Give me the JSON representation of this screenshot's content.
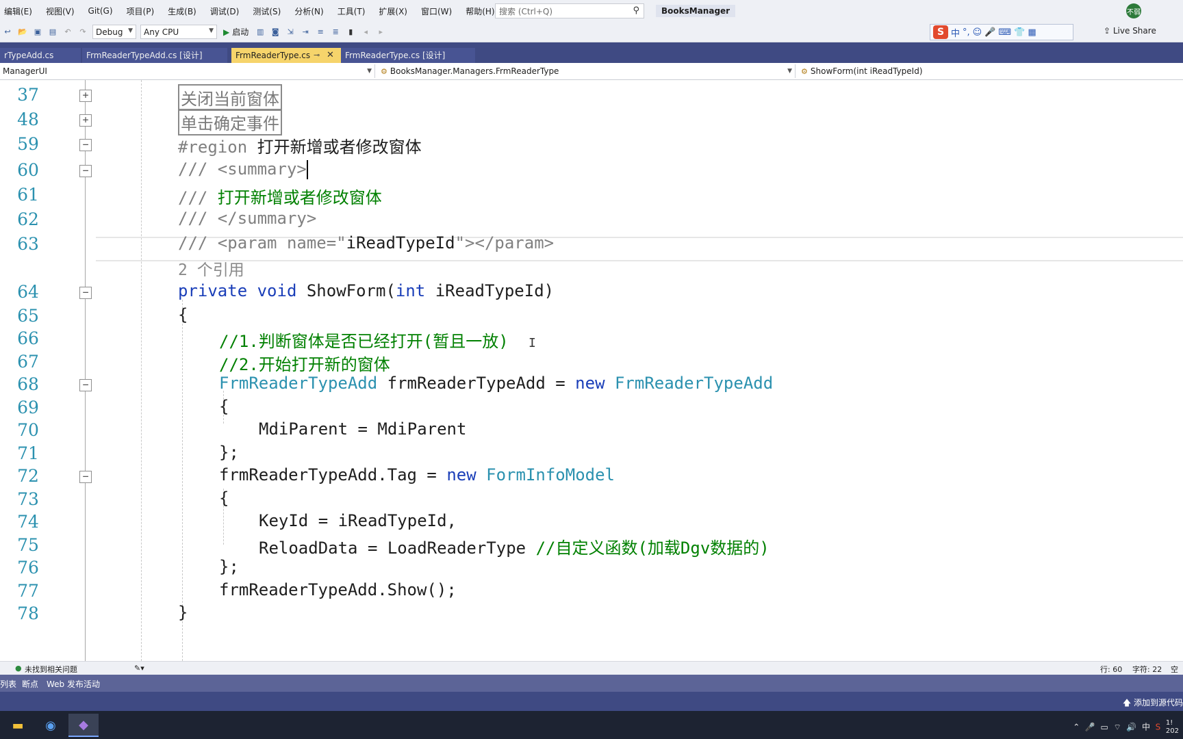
{
  "menubar": {
    "items": [
      "编辑(E)",
      "视图(V)",
      "Git(G)",
      "项目(P)",
      "生成(B)",
      "调试(D)",
      "测试(S)",
      "分析(N)",
      "工具(T)",
      "扩展(X)",
      "窗口(W)",
      "帮助(H)"
    ],
    "search_placeholder": "搜索 (Ctrl+Q)",
    "solution_name": "BooksManager",
    "avatar_text": "不弱"
  },
  "toolbar": {
    "config": "Debug",
    "platform": "Any CPU",
    "start_label": "启动",
    "ime_chars": [
      "中",
      "°,",
      "☺",
      "🎤",
      "⌨",
      "👕",
      "▦"
    ],
    "live_share": "Live Share"
  },
  "tabs": [
    {
      "label": "rTypeAdd.cs",
      "active": false
    },
    {
      "label": "FrmReaderTypeAdd.cs [设计]",
      "active": false
    },
    {
      "label": "FrmReaderType.cs",
      "active": true
    },
    {
      "label": "FrmReaderType.cs [设计]",
      "active": false
    }
  ],
  "navbar": {
    "project": "ManagerUI",
    "class": "BooksManager.Managers.FrmReaderType",
    "member": "ShowForm(int iReadTypeId)"
  },
  "editor": {
    "lines": [
      {
        "num": "37",
        "fold": "+",
        "text": "关闭当前窗体"
      },
      {
        "num": "48",
        "fold": "+",
        "text": "单击确定事件"
      },
      {
        "num": "59",
        "fold": "−",
        "kw": "#region",
        "text": " 打开新增或者修改窗体"
      },
      {
        "num": "60",
        "fold": "−",
        "text": "/// <summary>"
      },
      {
        "num": "61",
        "fold": "",
        "doc": "/// ",
        "text": "打开新增或者修改窗体"
      },
      {
        "num": "62",
        "fold": "",
        "text": "/// </summary>"
      },
      {
        "num": "63",
        "fold": "",
        "doc1": "/// <param name=\"",
        "text": "iReadTypeId",
        "doc2": "\"></param>"
      },
      {
        "num": "",
        "fold": "",
        "text": "2 个引用"
      },
      {
        "num": "64",
        "fold": "−",
        "kw1": "private",
        "kw2": "void",
        "name": "ShowForm(",
        "kw3": "int",
        "text": " iReadTypeId)"
      },
      {
        "num": "65",
        "fold": "",
        "text": "{"
      },
      {
        "num": "66",
        "fold": "",
        "text": "//1.判断窗体是否已经打开(暂且一放)"
      },
      {
        "num": "67",
        "fold": "",
        "text": "//2.开始打开新的窗体"
      },
      {
        "num": "68",
        "fold": "−",
        "type1": "FrmReaderTypeAdd",
        "text": " frmReaderTypeAdd = ",
        "kw": "new",
        "type2": " FrmReaderTypeAdd"
      },
      {
        "num": "69",
        "fold": "",
        "text": "{"
      },
      {
        "num": "70",
        "fold": "",
        "text": "MdiParent = MdiParent"
      },
      {
        "num": "71",
        "fold": "",
        "text": "};"
      },
      {
        "num": "72",
        "fold": "−",
        "text": "frmReaderTypeAdd.Tag = ",
        "kw": "new",
        "type": " FormInfoModel"
      },
      {
        "num": "73",
        "fold": "",
        "text": "{"
      },
      {
        "num": "74",
        "fold": "",
        "text": "KeyId = iReadTypeId,"
      },
      {
        "num": "75",
        "fold": "",
        "text": "ReloadData = LoadReaderType ",
        "comment": "//自定义函数(加载Dgv数据的)"
      },
      {
        "num": "76",
        "fold": "",
        "text": "};"
      },
      {
        "num": "77",
        "fold": "",
        "text": "frmReaderTypeAdd.Show();"
      },
      {
        "num": "78",
        "fold": "",
        "text": "}"
      }
    ]
  },
  "status": {
    "issues": "未找到相关问题",
    "line": "行: 60",
    "char": "字符: 22",
    "tail": "空格"
  },
  "toolwin_tabs": [
    "列表",
    "断点",
    "Web 发布活动"
  ],
  "vs_status": {
    "source_control": "添加到源代码"
  },
  "taskbar": {
    "tray_ime": "中",
    "clock_top": "1!",
    "clock_bottom": "202"
  },
  "colors": {
    "tab_active": "#f6d46b",
    "tab_well": "#3f4a83",
    "keyword": "#1a3eb8",
    "type": "#2b91af",
    "comment": "#008000"
  }
}
